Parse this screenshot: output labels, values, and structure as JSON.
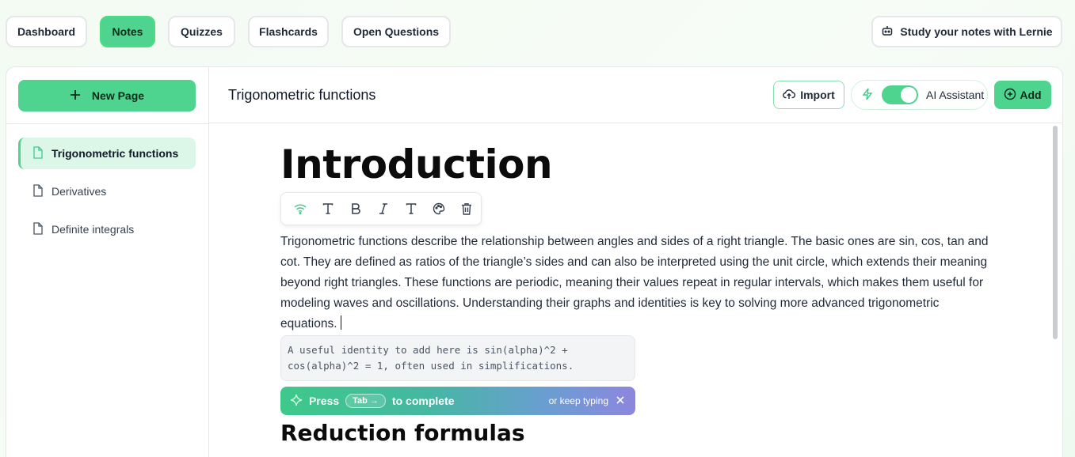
{
  "nav": {
    "tabs": [
      {
        "label": "Dashboard",
        "active": false
      },
      {
        "label": "Notes",
        "active": true
      },
      {
        "label": "Quizzes",
        "active": false
      },
      {
        "label": "Flashcards",
        "active": false
      },
      {
        "label": "Open Questions",
        "active": false
      }
    ],
    "study_label": "Study your notes with Lernie"
  },
  "sidebar": {
    "new_page_label": "New Page",
    "items": [
      {
        "label": "Trigonometric functions",
        "active": true
      },
      {
        "label": "Derivatives",
        "active": false
      },
      {
        "label": "Definite integrals",
        "active": false
      }
    ]
  },
  "header": {
    "page_title": "Trigonometric functions",
    "import_label": "Import",
    "ai_label": "AI Assistant",
    "ai_enabled": true,
    "add_label": "Add"
  },
  "editor": {
    "heading": "Introduction",
    "paragraph": "Trigonometric functions describe the relationship between angles and sides of a right triangle. The basic ones are sin, cos, tan and cot. They are defined as ratios of the triangle’s sides and can also be interpreted using the unit circle, which extends their meaning beyond right triangles. These functions are periodic, meaning their values repeat in regular intervals, which makes them useful for modeling waves and oscillations. Understanding their graphs and identities is key to solving more advanced trigonometric equations.",
    "suggestion": "A useful identity to add here is sin(alpha)^2 + cos(alpha)^2 = 1, often used in simplifications.",
    "press_label": "Press",
    "tab_key_label": "Tab →",
    "complete_label": "to complete",
    "keep_typing_label": "or keep typing",
    "subheading": "Reduction formulas"
  },
  "colors": {
    "accent": "#4fd48f",
    "active_item_bg": "#dcf7e8"
  }
}
